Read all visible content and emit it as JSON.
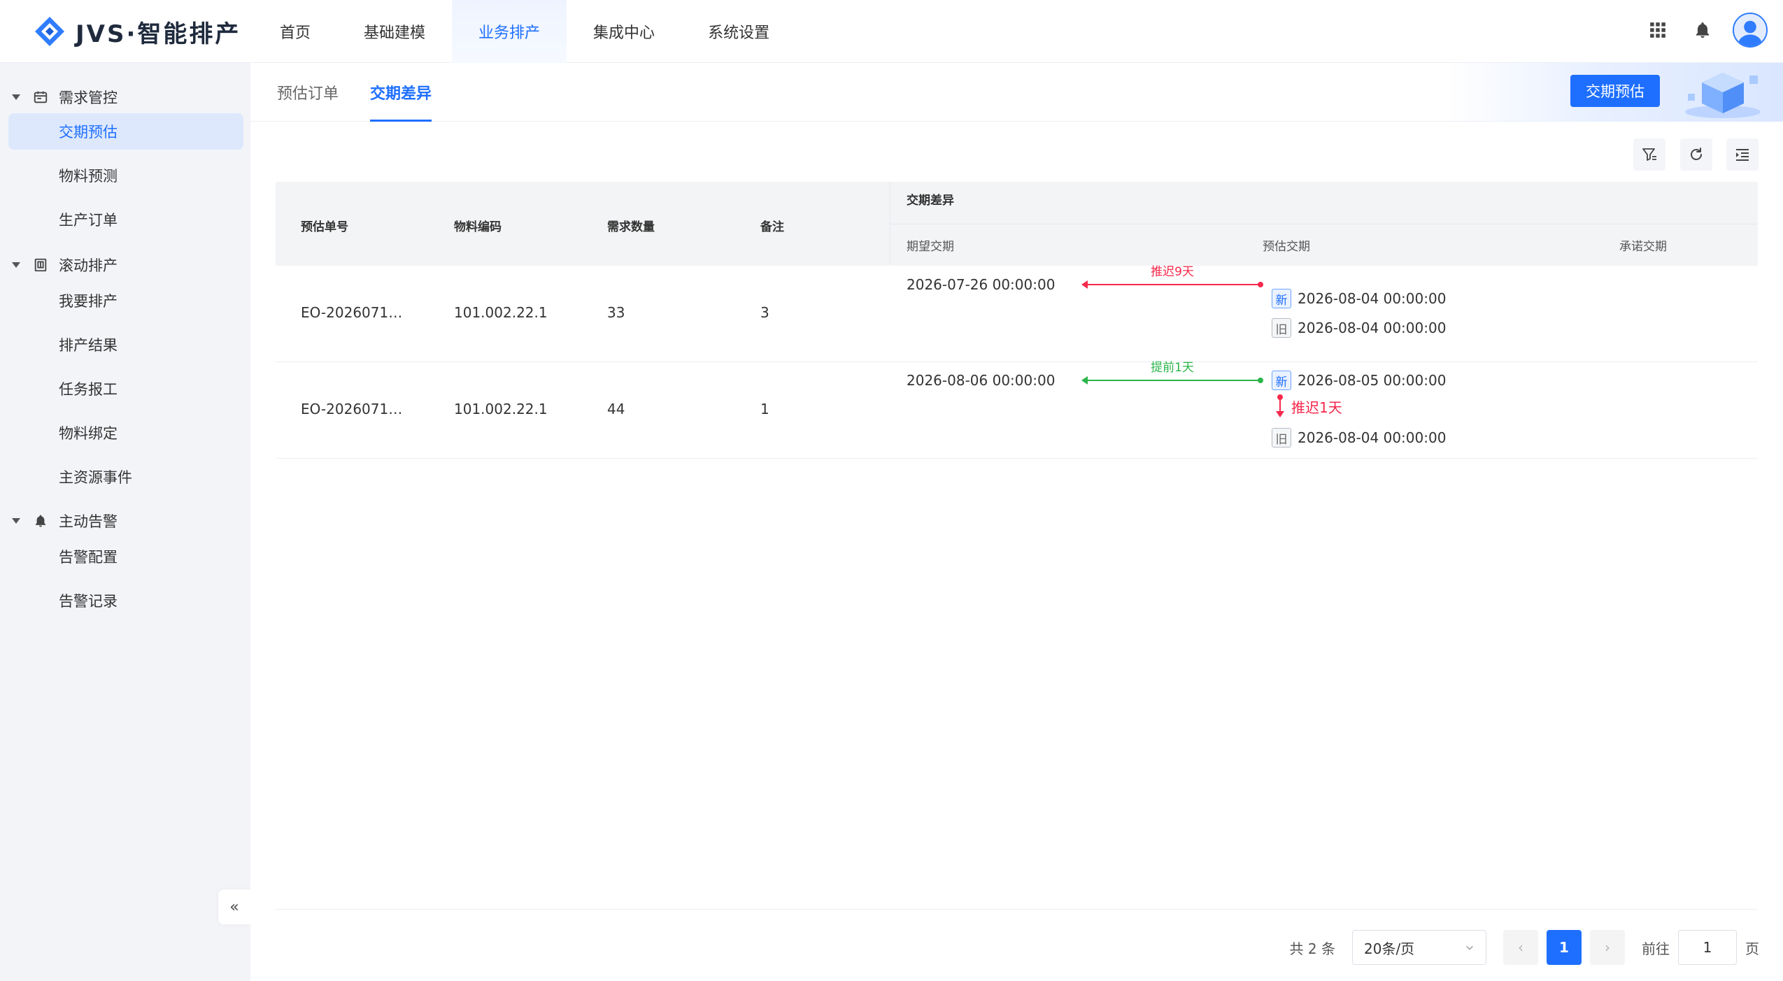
{
  "app": {
    "logo_text": "JVS·智能排产"
  },
  "topnav": [
    {
      "label": "首页"
    },
    {
      "label": "基础建模"
    },
    {
      "label": "业务排产",
      "active": true
    },
    {
      "label": "集成中心"
    },
    {
      "label": "系统设置"
    }
  ],
  "header_icons": [
    "apps-grid-icon",
    "bell-icon",
    "user-avatar-icon"
  ],
  "sidebar": {
    "groups": [
      {
        "label": "需求管控",
        "icon": "calendar-icon",
        "items": [
          {
            "label": "交期预估",
            "active": true
          },
          {
            "label": "物料预测"
          },
          {
            "label": "生产订单"
          }
        ]
      },
      {
        "label": "滚动排产",
        "icon": "building-icon",
        "items": [
          {
            "label": "我要排产"
          },
          {
            "label": "排产结果"
          },
          {
            "label": "任务报工"
          },
          {
            "label": "物料绑定"
          },
          {
            "label": "主资源事件"
          }
        ]
      },
      {
        "label": "主动告警",
        "icon": "bell-icon",
        "items": [
          {
            "label": "告警配置"
          },
          {
            "label": "告警记录"
          }
        ]
      }
    ],
    "collapse_label": "«"
  },
  "tabs": [
    {
      "label": "预估订单"
    },
    {
      "label": "交期差异",
      "active": true
    }
  ],
  "action_button": "交期预估",
  "toolbar_icons": [
    "filter-icon",
    "refresh-icon",
    "column-settings-icon"
  ],
  "table": {
    "columns": {
      "order_no": "预估单号",
      "material_code": "物料编码",
      "qty": "需求数量",
      "remark": "备注"
    },
    "group_header": "交期差异",
    "sub_columns": {
      "expected": "期望交期",
      "estimated": "预估交期",
      "promised": "承诺交期"
    },
    "rows": [
      {
        "order_no": "EO-2026071…",
        "material_code": "101.002.22.1",
        "qty": "33",
        "remark": "3",
        "expected": "2026-07-26 00:00:00",
        "diff_label": "推迟9天",
        "diff_color": "#f5294b",
        "new_tag": "新",
        "new_date": "2026-08-04 00:00:00",
        "old_tag": "旧",
        "old_date": "2026-08-04 00:00:00"
      },
      {
        "order_no": "EO-2026071…",
        "material_code": "101.002.22.1",
        "qty": "44",
        "remark": "1",
        "expected": "2026-08-06 00:00:00",
        "diff_label": "提前1天",
        "diff_color": "#2bb54a",
        "new_tag": "新",
        "new_date": "2026-08-05 00:00:00",
        "shift_label": "推迟1天",
        "old_tag": "旧",
        "old_date": "2026-08-04 00:00:00"
      }
    ]
  },
  "pagination": {
    "total": "共 2 条",
    "page_size": "20条/页",
    "prev": "‹",
    "current": "1",
    "next": "›",
    "goto_prefix": "前往",
    "goto_value": "1",
    "goto_suffix": "页"
  },
  "colors": {
    "primary": "#1e6fff",
    "delay": "#f5294b",
    "advance": "#2bb54a"
  }
}
